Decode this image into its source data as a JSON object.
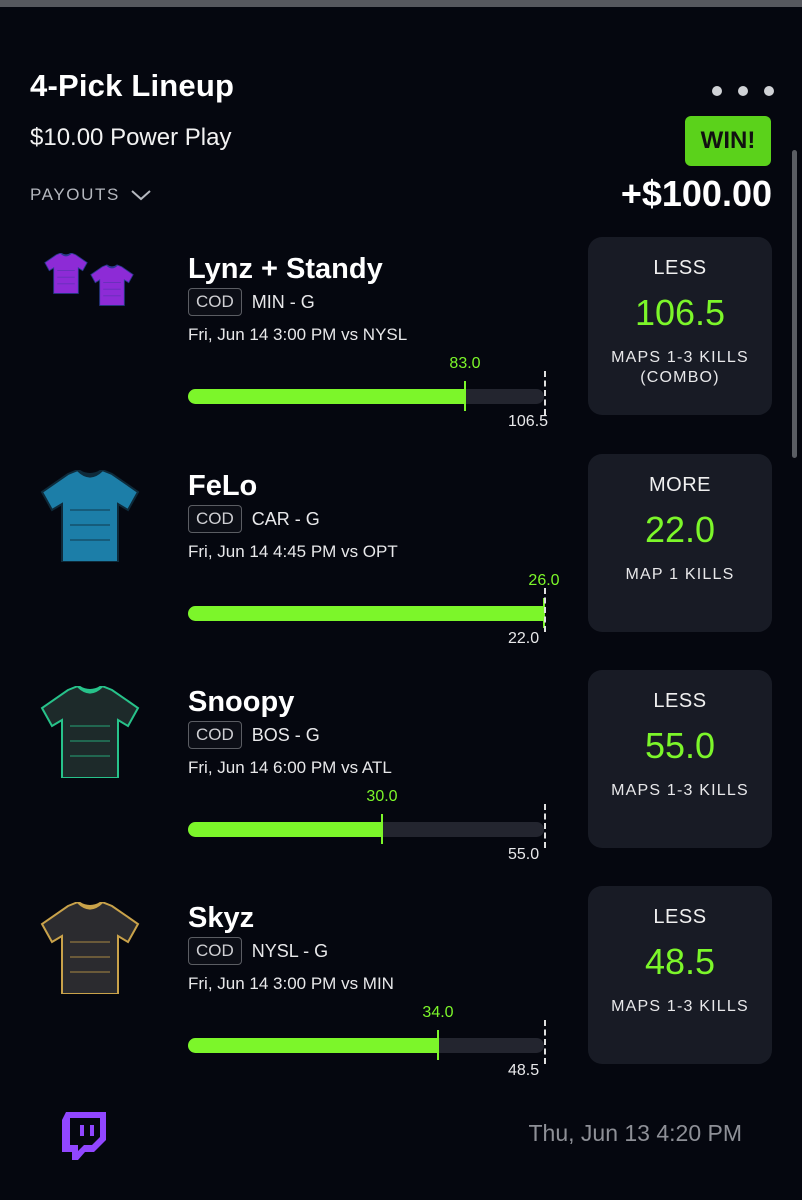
{
  "header": {
    "title": "4-Pick Lineup",
    "subtitle": "$10.00 Power Play",
    "payouts_label": "PAYOUTS",
    "result_badge": "WIN!",
    "payout_amount": "+$100.00",
    "menu_icon": "more-horizontal-icon"
  },
  "picks": [
    {
      "player": "Lynz + Standy",
      "league": "COD",
      "team_pos": "MIN - G",
      "game_time": "Fri, Jun 14 3:00 PM  vs NYSL",
      "actual": "83.0",
      "target": "106.5",
      "progress": 0.779,
      "direction": "LESS",
      "line": "106.5",
      "stat": "MAPS 1-3 KILLS (COMBO)",
      "jersey_colors": [
        "#8d2bd6",
        "#2a3a8f"
      ]
    },
    {
      "player": "FeLo",
      "league": "COD",
      "team_pos": "CAR - G",
      "game_time": "Fri, Jun 14 4:45 PM  vs OPT",
      "actual": "26.0",
      "target": "22.0",
      "progress": 1.0,
      "direction": "MORE",
      "line": "22.0",
      "stat": "MAP 1 KILLS",
      "jersey_colors": [
        "#1c7ea8",
        "#0e2a3a"
      ]
    },
    {
      "player": "Snoopy",
      "league": "COD",
      "team_pos": "BOS - G",
      "game_time": "Fri, Jun 14 6:00 PM  vs ATL",
      "actual": "30.0",
      "target": "55.0",
      "progress": 0.545,
      "direction": "LESS",
      "line": "55.0",
      "stat": "MAPS 1-3 KILLS",
      "jersey_colors": [
        "#1d2a2a",
        "#27c28a"
      ]
    },
    {
      "player": "Skyz",
      "league": "COD",
      "team_pos": "NYSL - G",
      "game_time": "Fri, Jun 14 3:00 PM  vs MIN",
      "actual": "34.0",
      "target": "48.5",
      "progress": 0.701,
      "direction": "LESS",
      "line": "48.5",
      "stat": "MAPS 1-3 KILLS",
      "jersey_colors": [
        "#2b2b2f",
        "#c9a24a"
      ]
    }
  ],
  "footer": {
    "date": "Thu, Jun 13 4:20 PM",
    "brand_icon": "twitch-icon"
  },
  "colors": {
    "accent_green": "#7cf62a",
    "win_green": "#5bd21b",
    "background": "#05070f",
    "card": "#181b25"
  }
}
